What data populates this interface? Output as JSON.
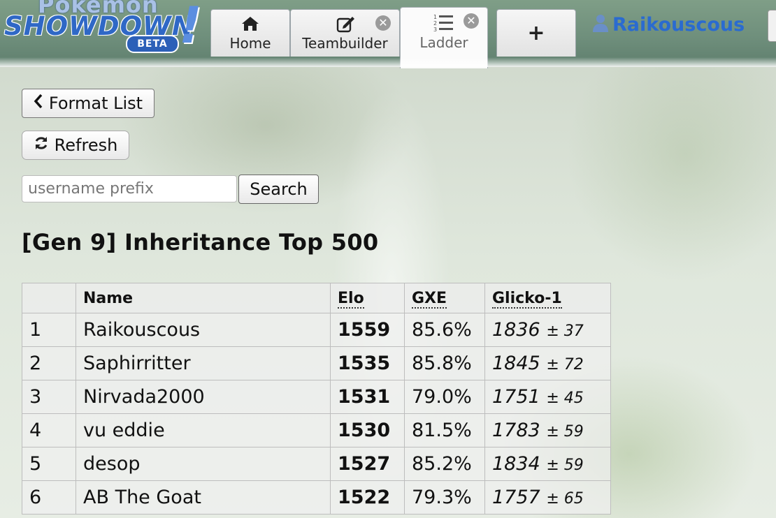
{
  "header": {
    "logo": {
      "pokemon": "Pokemon",
      "showdown": "SHOWDOWN",
      "beta": "BETA",
      "bang": "!"
    },
    "tabs": [
      {
        "label": "Home",
        "icon": "home-icon"
      },
      {
        "label": "Teambuilder",
        "icon": "pencil-square-icon",
        "closable": true
      },
      {
        "label": "Ladder",
        "icon": "list-ol-icon",
        "closable": true,
        "active": true
      }
    ],
    "new_tab_label": "+",
    "close_glyph": "✕",
    "username": "Raikouscous"
  },
  "controls": {
    "format_list_label": "Format List",
    "refresh_label": "Refresh",
    "search_placeholder": "username prefix",
    "search_value": "",
    "search_label": "Search"
  },
  "ladder": {
    "title": "[Gen 9] Inheritance Top 500",
    "columns": {
      "rank": "",
      "name": "Name",
      "elo": "Elo",
      "gxe": "GXE",
      "glicko": "Glicko-1"
    },
    "rows": [
      {
        "rank": "1",
        "name": "Raikouscous",
        "elo": "1559",
        "gxe": "85.6%",
        "glicko": "1836",
        "dev": "± 37"
      },
      {
        "rank": "2",
        "name": "Saphirritter",
        "elo": "1535",
        "gxe": "85.8%",
        "glicko": "1845",
        "dev": "± 72"
      },
      {
        "rank": "3",
        "name": "Nirvada2000",
        "elo": "1531",
        "gxe": "79.0%",
        "glicko": "1751",
        "dev": "± 45"
      },
      {
        "rank": "4",
        "name": "vu eddie",
        "elo": "1530",
        "gxe": "81.5%",
        "glicko": "1783",
        "dev": "± 59"
      },
      {
        "rank": "5",
        "name": "desop",
        "elo": "1527",
        "gxe": "85.2%",
        "glicko": "1834",
        "dev": "± 59"
      },
      {
        "rank": "6",
        "name": "AB The Goat",
        "elo": "1522",
        "gxe": "79.3%",
        "glicko": "1757",
        "dev": "± 65"
      }
    ]
  },
  "colors": {
    "username": "#2a6bd0",
    "logo_blue": "#2f68c6"
  }
}
